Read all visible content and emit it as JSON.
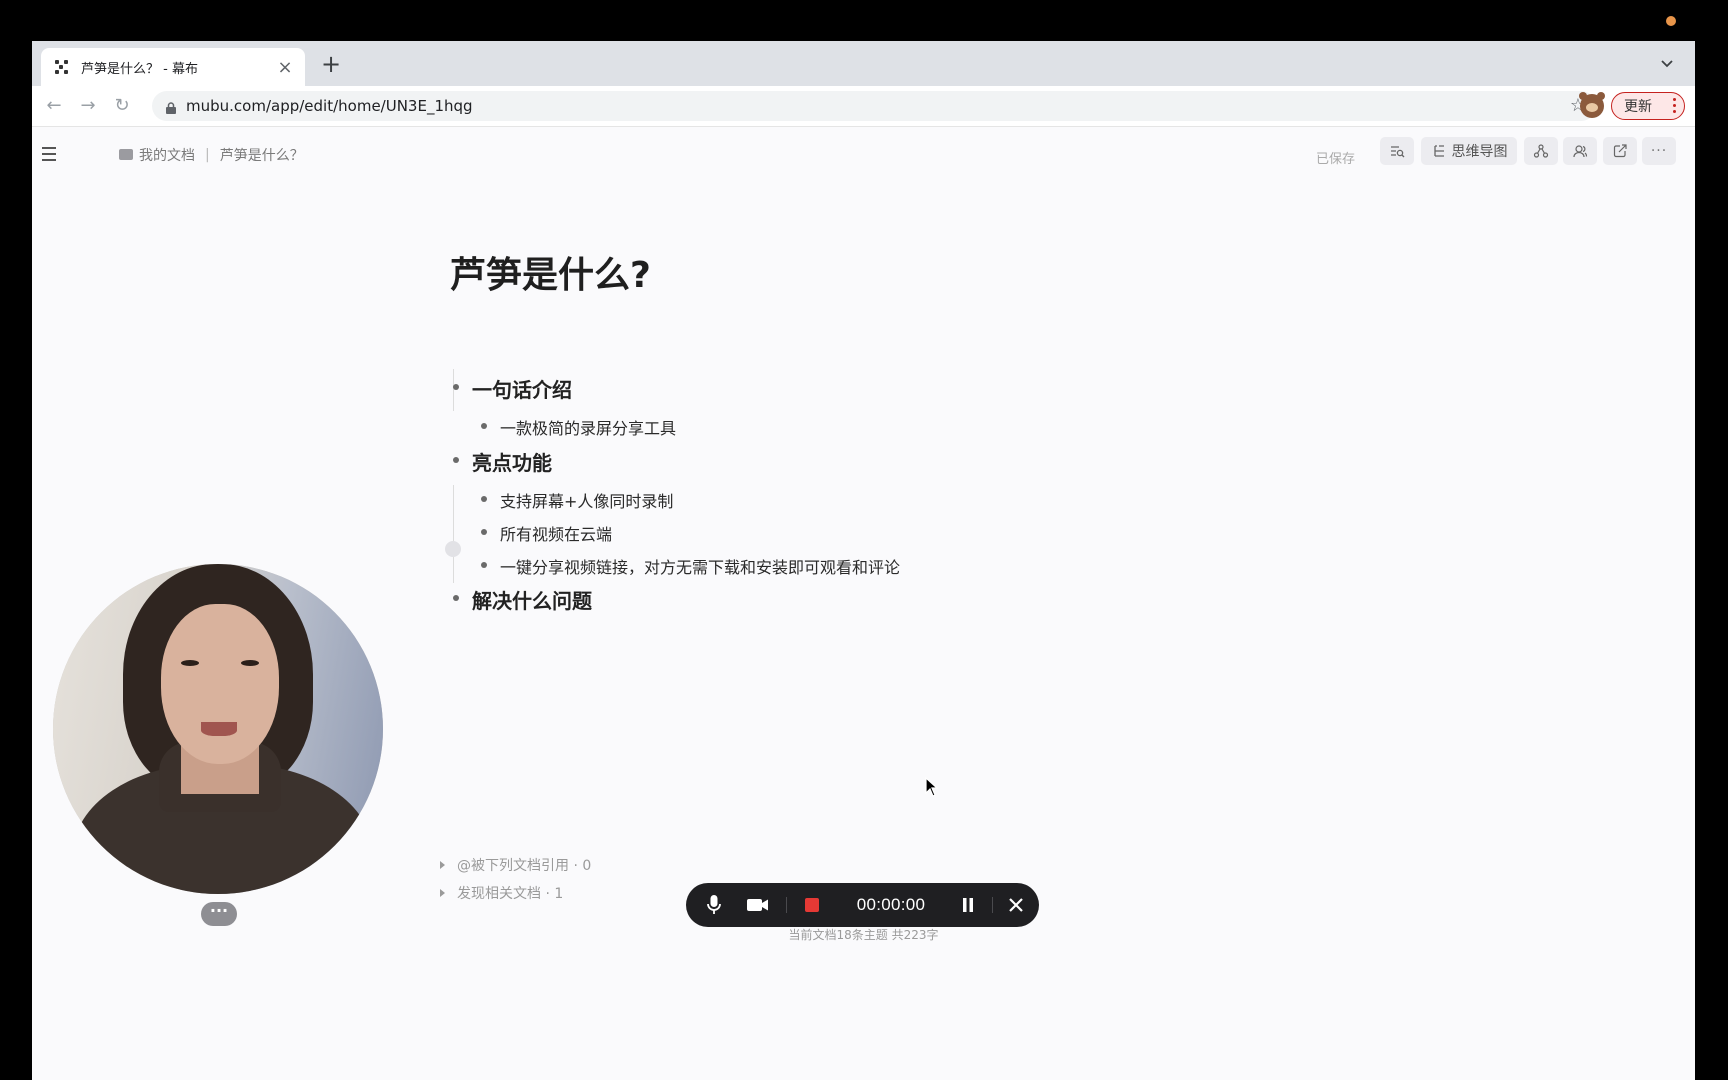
{
  "browser": {
    "tab_title": "芦笋是什么？ - 幕布",
    "new_tab": "+",
    "url": "mubu.com/app/edit/home/UN3E_1hqg",
    "update_label": "更新"
  },
  "app": {
    "breadcrumb": {
      "root": "我的文档",
      "separator": "|",
      "current": "芦笋是什么？"
    },
    "save_status": "已保存",
    "mindmap_label": "思维导图"
  },
  "document": {
    "title": "芦笋是什么?",
    "sections": [
      {
        "label": "一句话介绍",
        "children": [
          "一款极简的录屏分享工具"
        ]
      },
      {
        "label": "亮点功能",
        "children": [
          "支持屏幕+人像同时录制",
          "所有视频在云端",
          "一键分享视频链接，对方无需下载和安装即可观看和评论"
        ]
      },
      {
        "label": "解决什么问题",
        "children": []
      }
    ],
    "backlinks": "@被下列文档引用 · 0",
    "related": "发现相关文档 · 1",
    "footer_stats": "当前文档18条主题 共223字"
  },
  "webcam": {
    "more_label": "···"
  },
  "recorder": {
    "timer": "00:00:00"
  },
  "colors": {
    "record_red": "#e53935",
    "bar_bg": "#1f1f22",
    "update_border": "#c5221f"
  }
}
